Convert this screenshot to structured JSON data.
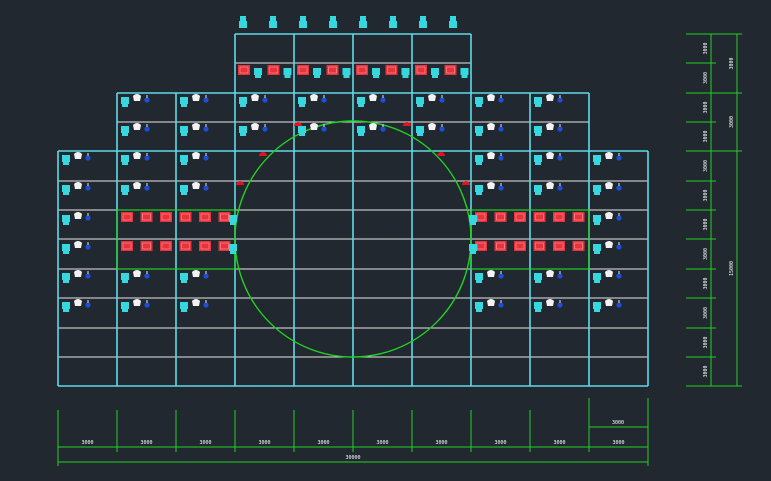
{
  "drawing": {
    "background": "#212830",
    "frame_color": "#5fd9e8",
    "grid_color": "#e6e6e6",
    "circle_color": "#22d022",
    "dim_color": "#22d022",
    "red_block_color": "#e8323c",
    "cyan_fixture_color": "#37d7df",
    "blue_fixture_color": "#1b4fd8",
    "white_fixture_color": "#f2f2f2",
    "red_marker_color": "#e0141e"
  },
  "bottom_dims": {
    "segments": [
      "3000",
      "3000",
      "3000",
      "3000",
      "3000",
      "3000",
      "3000",
      "3000",
      "3000",
      "3000"
    ],
    "right_segment": "3000",
    "total": "30000"
  },
  "right_dims": {
    "rows": [
      "3000",
      "3000",
      "3000",
      "3000",
      "3000",
      "3000",
      "3000",
      "3000",
      "3000",
      "3000",
      "3000",
      "3000"
    ],
    "groups": [
      "3000",
      "3000",
      "15000"
    ]
  },
  "icons": {
    "top_head": "lamp-head-icon",
    "cyan": "moving-head-cyan-icon",
    "blue": "spot-blue-icon",
    "white": "wash-white-icon",
    "red_block": "red-panel-icon",
    "red_marker": "red-marker-icon"
  }
}
